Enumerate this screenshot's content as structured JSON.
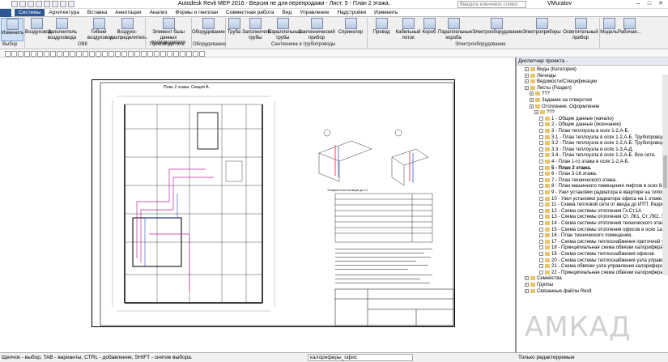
{
  "window": {
    "title": "Autodesk Revit MEP 2016 - Версия не для перепродажи -   Лист: 5 - План 2 этажа.",
    "search_placeholder": "Введите ключевое слово/фразу",
    "user": "VMuratov"
  },
  "tabs": [
    "Системы",
    "Архитектура",
    "Вставка",
    "Аннотации",
    "Анализ",
    "Формы и генплан",
    "Совместная работа",
    "Вид",
    "Управление",
    "Надстройки",
    "Изменить"
  ],
  "ribbon": {
    "buttons": [
      "Изменить",
      "Воздуховод",
      "Заполнитель воздуховода",
      "Гибкий воздуховод",
      "Воздухо-распределитель",
      "Элемент базы данных производителя",
      "Оборудование",
      "Труба",
      "Заполнитель трубы",
      "Параллельные трубы",
      "Сантехнический прибор",
      "Спринклер",
      "Провод",
      "Кабельный лоток",
      "Короб",
      "Параллельные короба",
      "Электрооборудование",
      "Электроприборы",
      "Осветительный прибор",
      "Модель",
      "Рабочая..."
    ],
    "groups": [
      "Выбор",
      "ОВК",
      "Производитель",
      "Оборудование",
      "Сантехника и трубопроводы",
      "Электрооборудование"
    ]
  },
  "sheet": {
    "plan_title": "План 2 этажа. Секция А.",
    "table_title": "Толщина слоя изоляции до 1,2"
  },
  "browser": {
    "title": "Диспетчер проекта -",
    "items": [
      "Виды (Категория)",
      "Легенды",
      "Ведомости/Спецификации",
      "Листы (Раздел)",
      "???",
      "Задание на отверстия",
      "Отопление. Оформление",
      "???",
      "1 - Общие данные (начало)",
      "2 - Общие данные (окончание)",
      "3 - План теплоузла в осях 1-2,А-Б.",
      "3.1 - План теплоузла в осях 1-2,А-Б. Трубопроводы тепловой",
      "3.2 - План теплоузла в осях 1-2,А-Б. Трубопроводы жилого",
      "3.3 - План теплоузла в осях 1-3,А-Д.",
      "3.4 - План теплоузла в осях 1-2,А-Б. Все сети.",
      "4 - План 1-го этажа в осях 1-2,А-Б.",
      "5 - План 2 этажа.",
      "6 - План 3-16 этажа.",
      "7 - План технического этажа.",
      "8 - План машинного помещения лифтов в осях 8а-12а и вент.",
      "9 - Узел установки радиатора в квартире на типовом этаже.",
      "10 - Узел установки радиатора офиса на 1 этаже, в лифтовом х",
      "11 - Схема тепловой сети от ввода до ИТП. Разрез 1-1. Разрез",
      "12 - Схема системы отопления Гк.Ст.1А",
      "13 - Схема системы отопления Ст. ЛК1, Ст. ЛК2. Узлы 1, 2, 3",
      "14 - Схема системы отопления технического этажа.",
      "15 - Схема системы отопления офисов в осях 1а-13а",
      "16 - План технического помещения.",
      "17 - Схема системы теплоснабжения приточной установки",
      "18 - Принципиальная схема обвязки калорифера приточной ус",
      "19 - Схема системы теплоснабжения офисов.",
      "20 - Схема системы теплоснабжения узла управления приточной у",
      "21 - Схема обвязки узла управления калорифера приточной у",
      "22 - Принципиальная схема обвязки калорифера приточной ус",
      "Семейства",
      "Группы",
      "Связанные файлы Revit"
    ]
  },
  "status": {
    "hint": "Щелчок - выбор, TAB - варианты, CTRL - добавление, SHIFT - снятие выбора.",
    "family": "калориферы_офис",
    "workset": "Только редактируемые"
  },
  "watermark": "АМКАД"
}
